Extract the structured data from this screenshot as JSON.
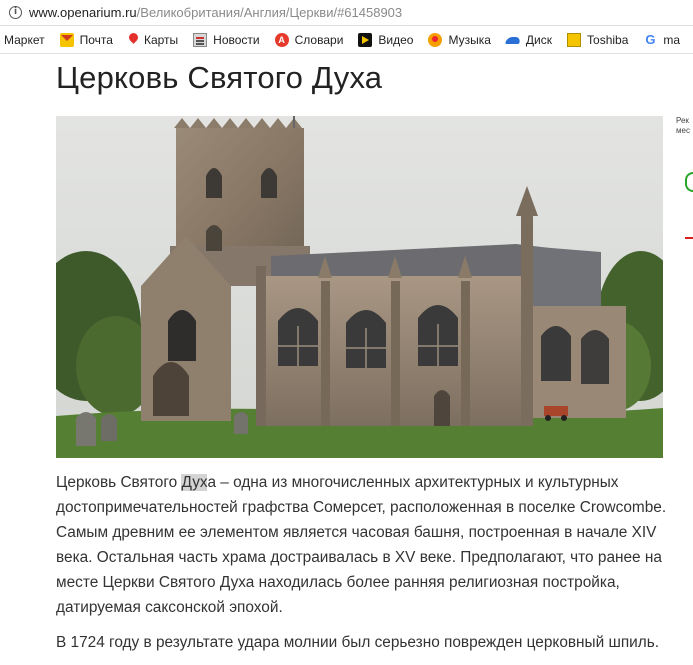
{
  "browser": {
    "url_host": "www.openarium.ru",
    "url_path": "/Великобритания/Англия/Церкви/#61458903"
  },
  "bookmarks": [
    {
      "label": "Маркет",
      "icon": "none"
    },
    {
      "label": "Почта",
      "icon": "mail-icon"
    },
    {
      "label": "Карты",
      "icon": "map-pin-icon"
    },
    {
      "label": "Новости",
      "icon": "news-icon"
    },
    {
      "label": "Словари",
      "icon": "dictionary-icon"
    },
    {
      "label": "Видео",
      "icon": "video-icon"
    },
    {
      "label": "Музыка",
      "icon": "music-icon"
    },
    {
      "label": "Диск",
      "icon": "disk-icon"
    },
    {
      "label": "Toshiba",
      "icon": "toshiba-icon"
    },
    {
      "label": "ma",
      "icon": "google-icon"
    }
  ],
  "article": {
    "title": "Церковь Святого Духа",
    "photo_alt": "church-photo",
    "paragraph1_before": "Церковь Святого ",
    "paragraph1_highlight": "Дух",
    "paragraph1_after": "а – одна из многочисленных архитектурных и культурных достопримечательностей графства Сомерсет, расположенная в поселке Crowcombe. Самым древним ее элементом является часовая башня, построенная в начале XIV века. Остальная часть храма достраивалась в XV веке. Предполагают, что ранее на месте Церкви Святого Духа находилась более ранняя религиозная постройка, датируемая саксонской эпохой.",
    "paragraph2": "В 1724 году в результате удара молнии был серьезно поврежден церковный шпиль."
  },
  "sidebar": {
    "ad_label_line1": "Рек",
    "ad_label_line2": "мес"
  },
  "colors": {
    "highlight": "#d4d4d4",
    "text": "#333333"
  }
}
